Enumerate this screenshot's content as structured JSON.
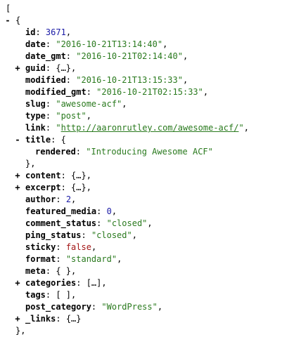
{
  "lines": [
    {
      "depth": 0,
      "open": "["
    },
    {
      "depth": 1,
      "toggle": "-",
      "open": "{"
    },
    {
      "depth": 2,
      "key": "id",
      "value": "3671",
      "vtype": "number",
      "comma": ","
    },
    {
      "depth": 2,
      "key": "date",
      "value": "\"2016-10-21T13:14:40\"",
      "vtype": "string",
      "comma": ","
    },
    {
      "depth": 2,
      "key": "date_gmt",
      "value": "\"2016-10-21T02:14:40\"",
      "vtype": "string",
      "comma": ","
    },
    {
      "depth": 2,
      "toggle": "+",
      "key": "guid",
      "value": "{…}",
      "vtype": "collapsed",
      "comma": ","
    },
    {
      "depth": 2,
      "key": "modified",
      "value": "\"2016-10-21T13:15:33\"",
      "vtype": "string",
      "comma": ","
    },
    {
      "depth": 2,
      "key": "modified_gmt",
      "value": "\"2016-10-21T02:15:33\"",
      "vtype": "string",
      "comma": ","
    },
    {
      "depth": 2,
      "key": "slug",
      "value": "\"awesome-acf\"",
      "vtype": "string",
      "comma": ","
    },
    {
      "depth": 2,
      "key": "type",
      "value": "\"post\"",
      "vtype": "string",
      "comma": ","
    },
    {
      "depth": 2,
      "key": "link",
      "quote": "\"",
      "link": "http://aaronrutley.com/awesome-acf/",
      "vtype": "link",
      "comma": ","
    },
    {
      "depth": 2,
      "toggle": "-",
      "key": "title",
      "open": "{"
    },
    {
      "depth": 3,
      "key": "rendered",
      "value": "\"Introducing Awesome ACF\"",
      "vtype": "string"
    },
    {
      "depth": 2,
      "close": "},"
    },
    {
      "depth": 2,
      "toggle": "+",
      "key": "content",
      "value": "{…}",
      "vtype": "collapsed",
      "comma": ","
    },
    {
      "depth": 2,
      "toggle": "+",
      "key": "excerpt",
      "value": "{…}",
      "vtype": "collapsed",
      "comma": ","
    },
    {
      "depth": 2,
      "key": "author",
      "value": "2",
      "vtype": "number",
      "comma": ","
    },
    {
      "depth": 2,
      "key": "featured_media",
      "value": "0",
      "vtype": "number",
      "comma": ","
    },
    {
      "depth": 2,
      "key": "comment_status",
      "value": "\"closed\"",
      "vtype": "string",
      "comma": ","
    },
    {
      "depth": 2,
      "key": "ping_status",
      "value": "\"closed\"",
      "vtype": "string",
      "comma": ","
    },
    {
      "depth": 2,
      "key": "sticky",
      "value": "false",
      "vtype": "bool",
      "comma": ","
    },
    {
      "depth": 2,
      "key": "format",
      "value": "\"standard\"",
      "vtype": "string",
      "comma": ","
    },
    {
      "depth": 2,
      "key": "meta",
      "value": "{ }",
      "vtype": "plain",
      "comma": ","
    },
    {
      "depth": 2,
      "toggle": "+",
      "key": "categories",
      "value": "[…]",
      "vtype": "collapsed",
      "comma": ","
    },
    {
      "depth": 2,
      "key": "tags",
      "value": "[ ]",
      "vtype": "plain",
      "comma": ","
    },
    {
      "depth": 2,
      "key": "post_category",
      "value": "\"WordPress\"",
      "vtype": "string",
      "comma": ","
    },
    {
      "depth": 2,
      "toggle": "+",
      "key": "_links",
      "value": "{…}",
      "vtype": "collapsed"
    },
    {
      "depth": 1,
      "close": "},"
    }
  ]
}
